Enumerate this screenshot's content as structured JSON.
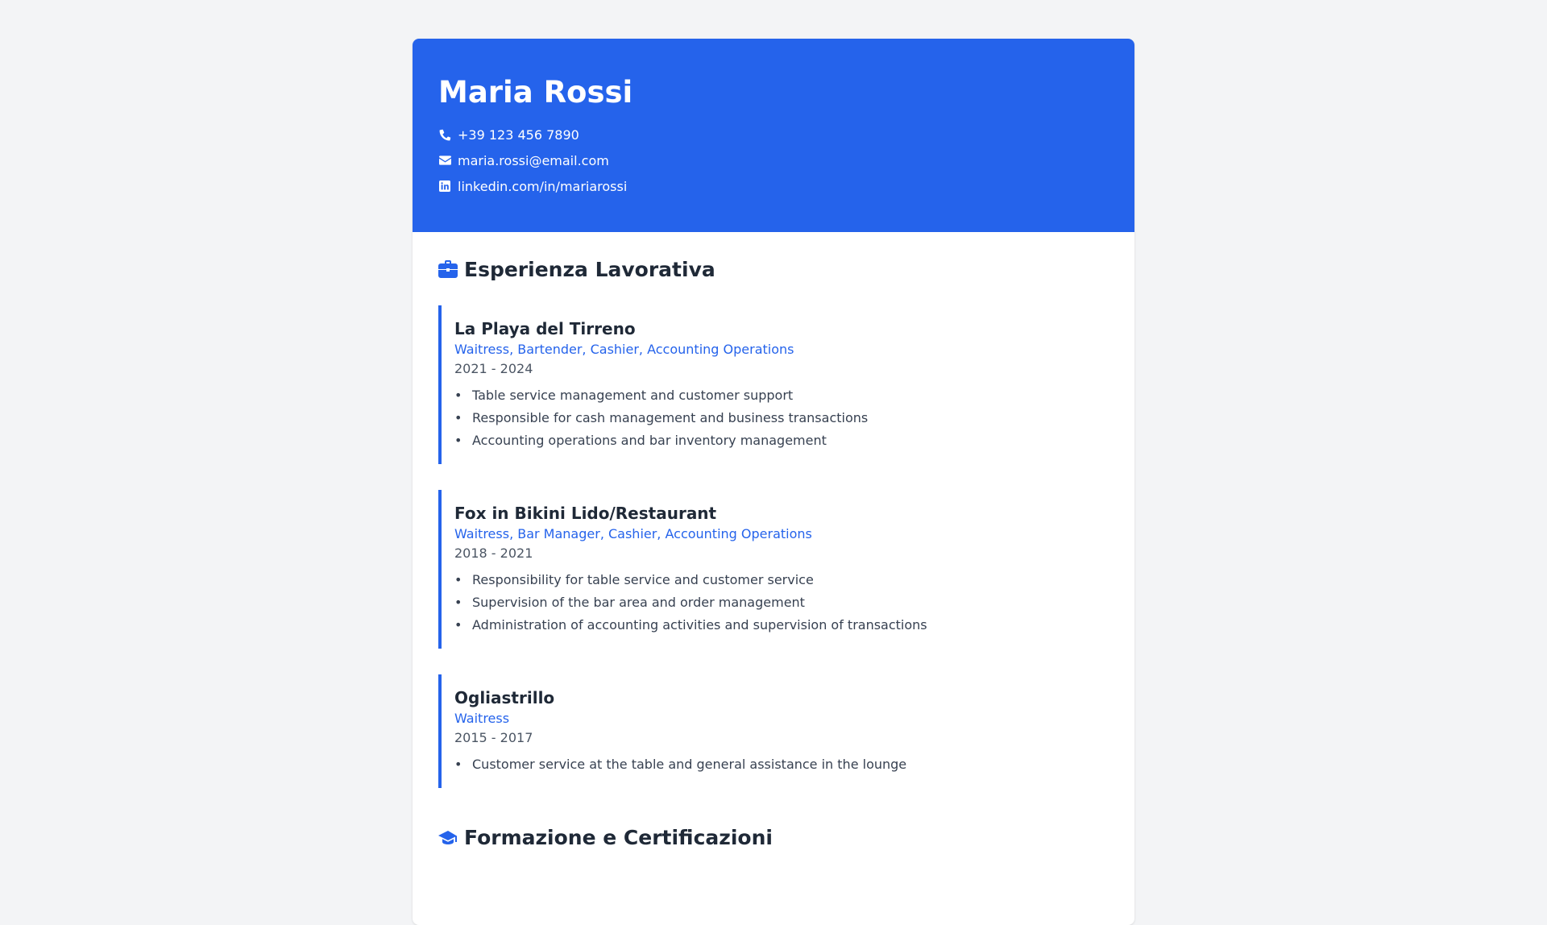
{
  "header": {
    "name": "Maria Rossi",
    "phone": "+39 123 456 7890",
    "email": "maria.rossi@email.com",
    "linkedin": "linkedin.com/in/mariarossi"
  },
  "experience": {
    "title": "Esperienza Lavorativa",
    "icon": "briefcase-icon",
    "items": [
      {
        "company": "La Playa del Tirreno",
        "role": "Waitress, Bartender, Cashier, Accounting Operations",
        "dates": "2021 - 2024",
        "bullets": [
          "Table service management and customer support",
          "Responsible for cash management and business transactions",
          "Accounting operations and bar inventory management"
        ]
      },
      {
        "company": "Fox in Bikini Lido/Restaurant",
        "role": "Waitress, Bar Manager, Cashier, Accounting Operations",
        "dates": "2018 - 2021",
        "bullets": [
          "Responsibility for table service and customer service",
          "Supervision of the bar area and order management",
          "Administration of accounting activities and supervision of transactions"
        ]
      },
      {
        "company": "Ogliastrillo",
        "role": "Waitress",
        "dates": "2015 - 2017",
        "bullets": [
          "Customer service at the table and general assistance in the lounge"
        ]
      }
    ]
  },
  "education": {
    "title": "Formazione e Certificazioni",
    "icon": "graduation-cap-icon"
  },
  "colors": {
    "accent": "#2563eb",
    "background": "#f3f4f6",
    "text": "#1f2937"
  }
}
